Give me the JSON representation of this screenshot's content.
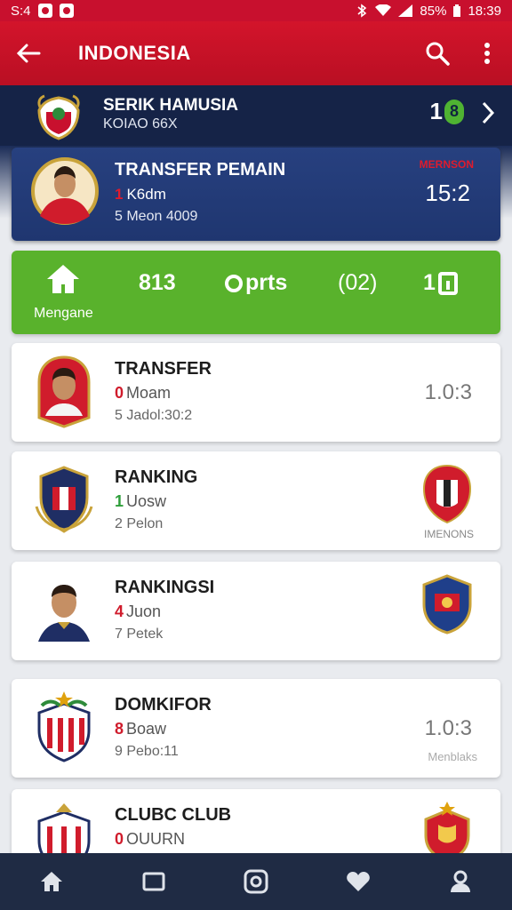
{
  "status_bar": {
    "left_text": "S:4",
    "battery": "85%",
    "time": "18:39"
  },
  "app_bar": {
    "title": "INDONESIA"
  },
  "match": {
    "title": "SERIK HAMUSIA",
    "subtitle": "KOIAO 66X",
    "score": "1",
    "badge": "8"
  },
  "feature": {
    "title": "TRANSFER PEMAIN",
    "line1_num": "1",
    "line1_text": "K6dm",
    "line2": "5 Meon 4009",
    "tag": "MERNSON",
    "time": "15:2"
  },
  "stats": {
    "home_label": "Mengane",
    "v1": "813",
    "v2": "prts",
    "v3": "(02)",
    "v4": "1"
  },
  "cards": [
    {
      "title": "TRANSFER",
      "num": "0",
      "num_color": "#d01c2c",
      "text": "Moam",
      "line2": "5 Jadol:30:2",
      "score": "1.0:3"
    },
    {
      "title": "RANKING",
      "num": "1",
      "num_color": "#2e9e3a",
      "text": "Uosw",
      "line2": "2 Pelon",
      "crest_label": "IMENONS"
    },
    {
      "title": "RANKINGSI",
      "num": "4",
      "num_color": "#d01c2c",
      "text": "Juon",
      "line2": "7 Petek"
    },
    {
      "title": "DOMKIFOR",
      "num": "8",
      "num_color": "#d01c2c",
      "text": "Boaw",
      "line2": "9 Pebo:11",
      "score": "1.0:3",
      "sub": "Menblaks"
    },
    {
      "title": "CLUBC CLUB",
      "num": "0",
      "num_color": "#d01c2c",
      "text": "OUURN",
      "line2": ""
    }
  ],
  "colors": {
    "primary": "#c8102e",
    "navy": "#152347",
    "green": "#59b22c"
  },
  "icons": [
    "arrow-left-icon",
    "search-icon",
    "more-vert-icon",
    "home-icon",
    "square-icon",
    "camera-icon",
    "heart-icon",
    "profile-icon"
  ]
}
